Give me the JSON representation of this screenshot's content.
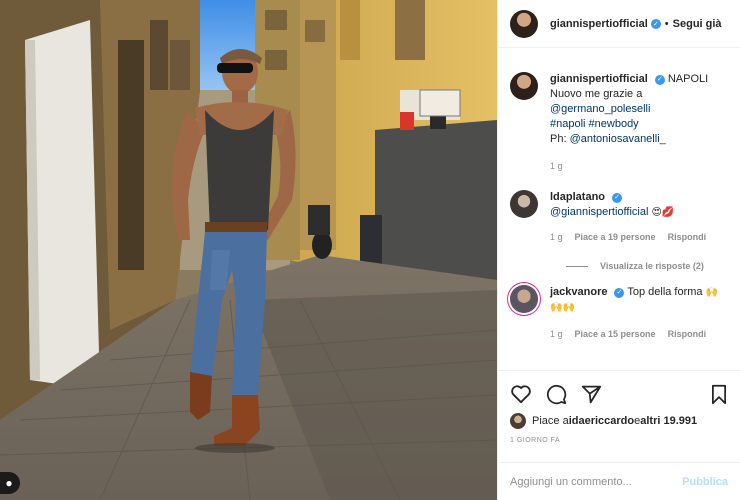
{
  "post": {
    "author": "giannispertiofficial",
    "location": "NAPOLI",
    "follow_label": "Segui già",
    "caption_lines": [
      "Nuovo me grazie a",
      "@germano_poleselli",
      "#napoli #newbody"
    ],
    "photo_credit_prefix": "Ph: ",
    "photo_credit_mention": "@antoniosavanelli_",
    "caption_time": "1 g"
  },
  "comments": [
    {
      "user": "ldaplatano",
      "mention": "@giannispertiofficial",
      "emojis": "😍💋",
      "time": "1 g",
      "likes": "Piace a 19 persone",
      "reply_label": "Rispondi",
      "view_replies": "Visualizza le risposte (2)"
    },
    {
      "user": "jackvanore",
      "text": "Top della forma",
      "emojis": "🙌🙌",
      "trailing_emoji": "🙌",
      "time": "1 g",
      "likes": "Piace a 15 persone",
      "reply_label": "Rispondi"
    }
  ],
  "likes": {
    "prefix": "Piace a ",
    "user": "idaericcardo",
    "middle": " e ",
    "others": "altri 19.991"
  },
  "date_label": "1 GIORNO FA",
  "comment_box": {
    "placeholder": "Aggiungi un commento...",
    "publish_label": "Pubblica"
  },
  "icons": [
    "heart-icon",
    "comment-icon",
    "share-icon",
    "bookmark-icon",
    "verified-badge-icon"
  ],
  "colors": {
    "link": "#00376b",
    "verified": "#3897f0",
    "publish": "#b2dffc",
    "muted": "#8e8e8e"
  }
}
